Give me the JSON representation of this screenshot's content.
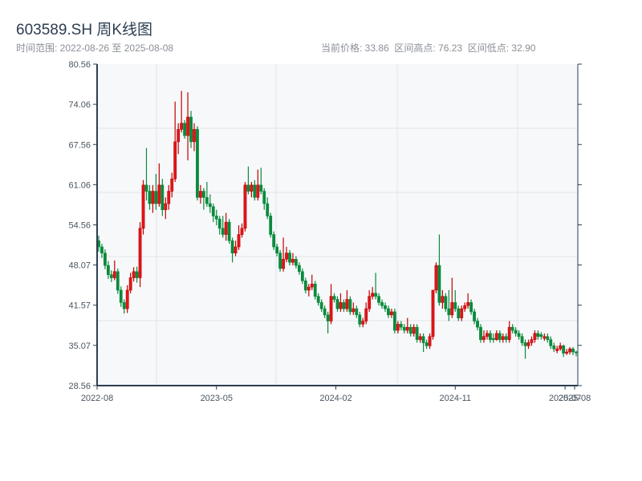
{
  "header": {
    "title": "603589.SH 周K线图",
    "range_text": "时间范围: 2022-08-26 至 2025-08-08",
    "stats_text": "当前价格: 33.86  区间高点: 76.23  区间低点: 32.90"
  },
  "colors": {
    "up": "#e0161b",
    "up_border": "#c40000",
    "down": "#0b8a3c",
    "axis": "#2c3e50",
    "plot_bg": "#f6f8fa",
    "grid": "#e1e4ea"
  },
  "chart_data": {
    "type": "candlestick",
    "title": "603589.SH 周K线图",
    "xlabel": "",
    "ylabel": "",
    "ylim": [
      28.56,
      80.56
    ],
    "y_ticks": [
      "28.56",
      "35.07",
      "41.57",
      "48.07",
      "54.56",
      "61.06",
      "67.56",
      "74.06",
      "80.56"
    ],
    "x_ticks": [
      {
        "label": "2022-08",
        "index": 0
      },
      {
        "label": "2023-05",
        "index": 37.5
      },
      {
        "label": "2024-02",
        "index": 75
      },
      {
        "label": "2024-11",
        "index": 112.5
      },
      {
        "label": "2025-07",
        "index": 147
      },
      {
        "label": "2025-08",
        "index": 150
      }
    ],
    "grid": true,
    "up_color_meaning": "red = up, green = down",
    "ohlc": [
      [
        52,
        52.8,
        50.2,
        51
      ],
      [
        51,
        51.5,
        49.2,
        50
      ],
      [
        50,
        50.6,
        47.4,
        48
      ],
      [
        48,
        48.7,
        45.8,
        46.5
      ],
      [
        46.5,
        47.2,
        45.3,
        46
      ],
      [
        46,
        48.8,
        45.6,
        47
      ],
      [
        47,
        47.5,
        43.4,
        44
      ],
      [
        44,
        44.6,
        41.3,
        42
      ],
      [
        42,
        42.5,
        40.2,
        41
      ],
      [
        41,
        44.8,
        40.3,
        44
      ],
      [
        44,
        46.8,
        43.5,
        46
      ],
      [
        46,
        47.7,
        45.4,
        47
      ],
      [
        47,
        47.8,
        45.2,
        46
      ],
      [
        46,
        55,
        44.5,
        54
      ],
      [
        54,
        61.8,
        53,
        61
      ],
      [
        61,
        67,
        58.5,
        60
      ],
      [
        60,
        61,
        57,
        58
      ],
      [
        58,
        61,
        56.5,
        60
      ],
      [
        60,
        62.8,
        57,
        58
      ],
      [
        58,
        64.5,
        57.5,
        61
      ],
      [
        61,
        62,
        56,
        57
      ],
      [
        57,
        59,
        55.5,
        58
      ],
      [
        58,
        61,
        57,
        60
      ],
      [
        60,
        63,
        59,
        62
      ],
      [
        62,
        74.5,
        61.5,
        68
      ],
      [
        68,
        71,
        66,
        70
      ],
      [
        70,
        76.23,
        69.5,
        71
      ],
      [
        71,
        71.5,
        68.5,
        69
      ],
      [
        69,
        76,
        65,
        72
      ],
      [
        72,
        73,
        67,
        68
      ],
      [
        68,
        71,
        66.5,
        70
      ],
      [
        70,
        70.5,
        58.5,
        59
      ],
      [
        59,
        61,
        58,
        60
      ],
      [
        60,
        60.5,
        57,
        59
      ],
      [
        59,
        61.5,
        57.5,
        58
      ],
      [
        58,
        59.5,
        56.5,
        57.5
      ],
      [
        57.5,
        58,
        55,
        56
      ],
      [
        56,
        57,
        54.5,
        55.5
      ],
      [
        55.5,
        56,
        53,
        54
      ],
      [
        54,
        56,
        52.5,
        53
      ],
      [
        53,
        56.5,
        52,
        55
      ],
      [
        55,
        55.5,
        51.5,
        52
      ],
      [
        52,
        52.5,
        48.5,
        50
      ],
      [
        50,
        52,
        49.5,
        51
      ],
      [
        51,
        54.5,
        50.5,
        53
      ],
      [
        53,
        54.8,
        52.5,
        54
      ],
      [
        54,
        61.5,
        53.5,
        61
      ],
      [
        61,
        64,
        59.5,
        60
      ],
      [
        60,
        61.5,
        59,
        61
      ],
      [
        61,
        61.8,
        58.5,
        59
      ],
      [
        59,
        63.5,
        58.5,
        61
      ],
      [
        61,
        63.8,
        59.5,
        60
      ],
      [
        60,
        60.5,
        57,
        58
      ],
      [
        58,
        59,
        55.5,
        56
      ],
      [
        56,
        56.5,
        52.5,
        53
      ],
      [
        53,
        53.5,
        50.5,
        51
      ],
      [
        51,
        51.5,
        49.5,
        50
      ],
      [
        50,
        50.5,
        47,
        47.5
      ],
      [
        47.5,
        52.5,
        47,
        49
      ],
      [
        49,
        51,
        48.5,
        50
      ],
      [
        50,
        50.5,
        48,
        48.5
      ],
      [
        48.5,
        50,
        48,
        49
      ],
      [
        49,
        49.5,
        47.5,
        48
      ],
      [
        48,
        48.5,
        46.5,
        47
      ],
      [
        47,
        47.5,
        45,
        45.5
      ],
      [
        45.5,
        46,
        43.5,
        44
      ],
      [
        44,
        45,
        43,
        44.5
      ],
      [
        44.5,
        46.5,
        44,
        45
      ],
      [
        45,
        45.5,
        42.5,
        43
      ],
      [
        43,
        43.5,
        41.5,
        42
      ],
      [
        42,
        42.5,
        40.5,
        41
      ],
      [
        41,
        41.5,
        39.5,
        40
      ],
      [
        40,
        40.5,
        37,
        39
      ],
      [
        39,
        45,
        38.5,
        43
      ],
      [
        43,
        43.5,
        42,
        42.5
      ],
      [
        42.5,
        43,
        40.5,
        41
      ],
      [
        41,
        43.5,
        40.5,
        42
      ],
      [
        42,
        42.5,
        40.5,
        41
      ],
      [
        41,
        44,
        40.5,
        42.5
      ],
      [
        42.5,
        43,
        40,
        40.5
      ],
      [
        40.5,
        42,
        40,
        41
      ],
      [
        41,
        41.5,
        39.5,
        40
      ],
      [
        40,
        40.5,
        38,
        38.5
      ],
      [
        38.5,
        39.5,
        38,
        39
      ],
      [
        39,
        42,
        38.5,
        41
      ],
      [
        41,
        44,
        40.5,
        43
      ],
      [
        43,
        44.5,
        42.5,
        43.5
      ],
      [
        43.5,
        46.8,
        42.5,
        43
      ],
      [
        43,
        43.5,
        41.5,
        42
      ],
      [
        42,
        42.5,
        41,
        41.5
      ],
      [
        41.5,
        42,
        40.5,
        41
      ],
      [
        41,
        41.5,
        39.5,
        40
      ],
      [
        40,
        41,
        39.5,
        40.5
      ],
      [
        40.5,
        41,
        37,
        37.5
      ],
      [
        37.5,
        39,
        37,
        38.5
      ],
      [
        38.5,
        39,
        37.5,
        38
      ],
      [
        38,
        38.5,
        37,
        37.5
      ],
      [
        37.5,
        39.5,
        37,
        38
      ],
      [
        38,
        38.5,
        36.5,
        37
      ],
      [
        37,
        38.5,
        36.5,
        38
      ],
      [
        38,
        38.5,
        35.5,
        36
      ],
      [
        36,
        37,
        35.5,
        36.5
      ],
      [
        36.5,
        37,
        34,
        35.5
      ],
      [
        35.5,
        36,
        34.5,
        35
      ],
      [
        35,
        37,
        34.5,
        36.5
      ],
      [
        36.5,
        44,
        36,
        44
      ],
      [
        44,
        48.5,
        43.5,
        48
      ],
      [
        48,
        53,
        41.5,
        42
      ],
      [
        42,
        44,
        41,
        43
      ],
      [
        43,
        43.5,
        40.5,
        41
      ],
      [
        41,
        44,
        39,
        40
      ],
      [
        40,
        46,
        39.5,
        42
      ],
      [
        42,
        44,
        40.5,
        41
      ],
      [
        41,
        41.5,
        39,
        39.5
      ],
      [
        39.5,
        41.5,
        39,
        41
      ],
      [
        41,
        42,
        40.5,
        41.5
      ],
      [
        41.5,
        43.5,
        41,
        42
      ],
      [
        42,
        42.5,
        40,
        40.5
      ],
      [
        40.5,
        41,
        38.5,
        39
      ],
      [
        39,
        39.5,
        37.5,
        38
      ],
      [
        38,
        38.5,
        35.5,
        36
      ],
      [
        36,
        37.5,
        35.5,
        36.5
      ],
      [
        36.5,
        37.5,
        36,
        37
      ],
      [
        37,
        37.5,
        35.5,
        36
      ],
      [
        36.2,
        37,
        35.5,
        36
      ],
      [
        36,
        37.5,
        35.8,
        37
      ],
      [
        37,
        37.5,
        35.5,
        36
      ],
      [
        36,
        37,
        35.5,
        36.5
      ],
      [
        36.5,
        37,
        35.5,
        36
      ],
      [
        36,
        39,
        35.5,
        38
      ],
      [
        38,
        38.5,
        37,
        37.5
      ],
      [
        37.5,
        38,
        36.5,
        37
      ],
      [
        37,
        37.5,
        36,
        36.5
      ],
      [
        36.5,
        37,
        35,
        35.5
      ],
      [
        35.5,
        36,
        32.9,
        35
      ],
      [
        35,
        36,
        34.5,
        35.5
      ],
      [
        35.5,
        36.5,
        35,
        36
      ],
      [
        36,
        37.5,
        35.5,
        37
      ],
      [
        37,
        37.5,
        36,
        36.5
      ],
      [
        36.8,
        37.2,
        36,
        36.5
      ],
      [
        36.2,
        37,
        35.8,
        36.5
      ],
      [
        36.5,
        37,
        35.5,
        36
      ],
      [
        36,
        36.5,
        34.5,
        35
      ],
      [
        35,
        35.5,
        34,
        34.5
      ],
      [
        34.2,
        35,
        33.8,
        34.5
      ],
      [
        34.5,
        35.5,
        34.2,
        35
      ],
      [
        35,
        35.2,
        33.2,
        33.8
      ],
      [
        33.8,
        34.5,
        33.5,
        34
      ],
      [
        34,
        34.8,
        33.6,
        34.5
      ],
      [
        34.5,
        34.8,
        33.5,
        34
      ],
      [
        34,
        34.2,
        33.3,
        33.86
      ]
    ]
  }
}
